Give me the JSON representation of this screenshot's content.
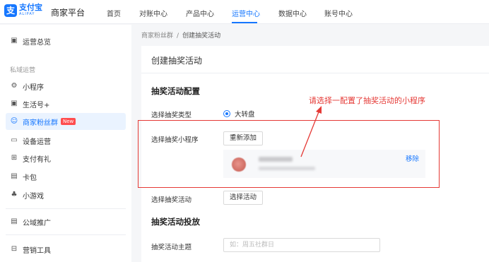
{
  "header": {
    "logo_glyph": "支",
    "logo_cn": "支付宝",
    "logo_en": "ALIPAY",
    "platform": "商家平台",
    "tabs": [
      {
        "label": "首页"
      },
      {
        "label": "对账中心"
      },
      {
        "label": "产品中心"
      },
      {
        "label": "运营中心",
        "active": true
      },
      {
        "label": "数据中心"
      },
      {
        "label": "账号中心"
      }
    ]
  },
  "sidebar": {
    "overview": "运营总览",
    "section_private": "私域运营",
    "items": [
      {
        "label": "小程序",
        "icon": "mini-program-icon",
        "glyph": "⚙"
      },
      {
        "label": "生活号+",
        "icon": "life-account-icon",
        "glyph": "▣"
      },
      {
        "label": "商家粉丝群",
        "icon": "fans-group-icon",
        "glyph": "☺",
        "active": true,
        "badge": "New"
      },
      {
        "label": "设备运营",
        "icon": "device-icon",
        "glyph": "▭"
      },
      {
        "label": "支付有礼",
        "icon": "gift-icon",
        "glyph": "⊞"
      },
      {
        "label": "卡包",
        "icon": "card-icon",
        "glyph": "▤"
      },
      {
        "label": "小游戏",
        "icon": "game-icon",
        "glyph": "♣"
      }
    ],
    "public_promo": "公域推广",
    "marketing_tools": "营销工具"
  },
  "breadcrumb": {
    "parent": "商家粉丝群",
    "separator": "/",
    "current": "创建抽奖活动"
  },
  "card": {
    "title": "创建抽奖活动",
    "config_title": "抽奖活动配置",
    "type_label": "选择抽奖类型",
    "type_option": "大转盘",
    "miniprogram_label": "选择抽奖小程序",
    "readd_button": "重新添加",
    "remove_link": "移除",
    "activity_label": "选择抽奖活动",
    "choose_activity_button": "选择活动",
    "delivery_title": "抽奖活动投放",
    "theme_label": "抽奖活动主题",
    "theme_placeholder": "如：周五社群日"
  },
  "annotation": {
    "text": "请选择一配置了抽奖活动的小程序",
    "color": "#e53935"
  },
  "colors": {
    "accent": "#1677ff",
    "new_badge": "#ff4d4f"
  }
}
